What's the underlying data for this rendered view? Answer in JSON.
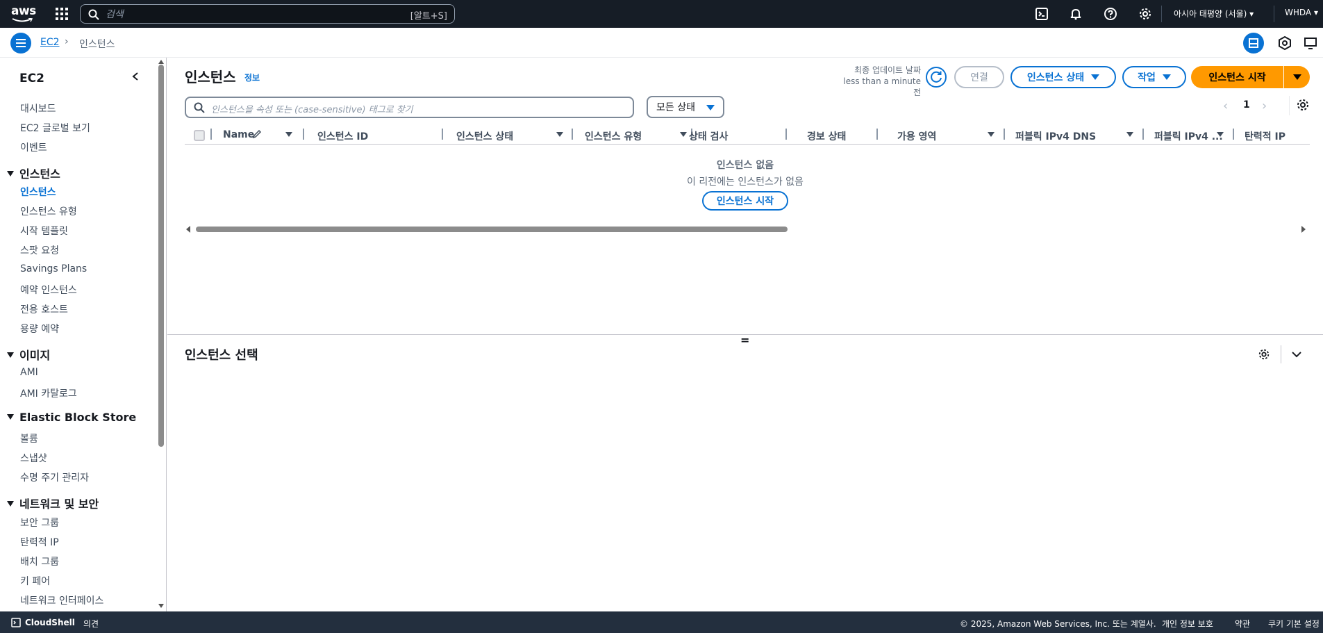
{
  "topnav": {
    "logo_text": "aws",
    "search_placeholder": "검색",
    "search_shortcut": "[알트+S]",
    "region": "아시아 태평양 (서울) ▾",
    "account": "WHDA ▾"
  },
  "breadcrumb": {
    "service": "EC2",
    "current": "인스턴스"
  },
  "sidebar": {
    "title": "EC2",
    "top_items": [
      "대시보드",
      "EC2 글로벌 보기",
      "이벤트"
    ],
    "sections": [
      {
        "title": "인스턴스",
        "items": [
          "인스턴스",
          "인스턴스 유형",
          "시작 템플릿",
          "스팟 요청",
          "Savings Plans",
          "예약 인스턴스",
          "전용 호스트",
          "용량 예약"
        ]
      },
      {
        "title": "이미지",
        "items": [
          "AMI",
          "AMI 카탈로그"
        ]
      },
      {
        "title": "Elastic Block Store",
        "items": [
          "볼륨",
          "스냅샷",
          "수명 주기 관리자"
        ]
      },
      {
        "title": "네트워크 및 보안",
        "items": [
          "보안 그룹",
          "탄력적 IP",
          "배치 그룹",
          "키 페어",
          "네트워크 인터페이스"
        ]
      }
    ],
    "active_item": "인스턴스"
  },
  "main": {
    "title": "인스턴스",
    "info_link": "정보",
    "last_updated_label": "최종 업데이트 날짜",
    "last_updated_value": "less than a minute 전",
    "buttons": {
      "connect": "연결",
      "instance_state": "인스턴스 상태",
      "actions": "작업",
      "launch": "인스턴스 시작"
    },
    "filter_placeholder": "인스턴스을 속성 또는 (case-sensitive) 태그로 찾기",
    "state_filter": "모든 상태",
    "page_number": "1",
    "columns": [
      "Name",
      "인스턴스 ID",
      "인스턴스 상태",
      "인스턴스 유형",
      "상태 검사",
      "경보 상태",
      "가용 영역",
      "퍼블릭 IPv4 DNS",
      "퍼블릭 IPv4 ...",
      "탄력적 IP"
    ],
    "empty_title": "인스턴스 없음",
    "empty_subtitle": "이 리전에는 인스턴스가 없음",
    "empty_button": "인스턴스 시작",
    "split_handle": "=",
    "split_title": "인스턴스 선택"
  },
  "footer": {
    "cloudshell": "CloudShell",
    "feedback": "의견",
    "copyright": "© 2025, Amazon Web Services, Inc. 또는 계열사.",
    "privacy": "개인 정보 보호",
    "terms": "약관",
    "cookies": "쿠키 기본 설정"
  },
  "colors": {
    "nav_bg": "#161d26",
    "accent": "#0972d3",
    "primary_button": "#ff9900",
    "footer_bg": "#232f3e"
  }
}
